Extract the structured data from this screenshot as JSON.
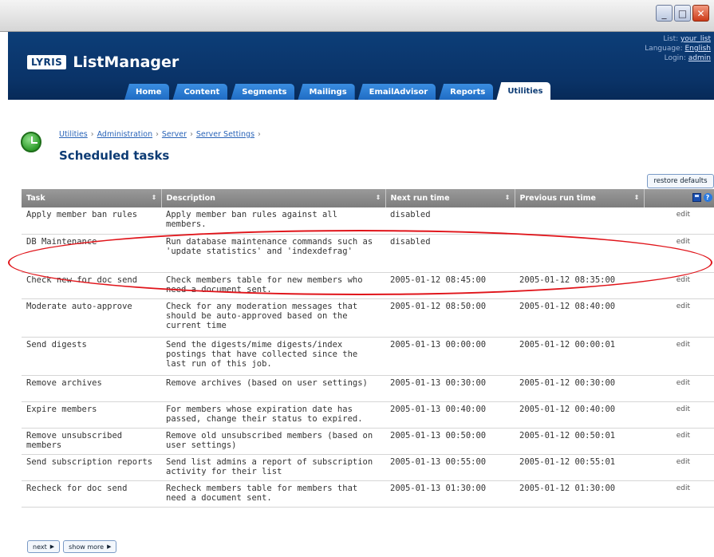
{
  "window": {
    "buttons": [
      "_",
      "□",
      "✕"
    ]
  },
  "header": {
    "logo_badge": "LYRIS",
    "app_name": "ListManager",
    "account": {
      "list_label": "List:",
      "list_value": "your_list",
      "language_label": "Language:",
      "language_value": "English",
      "login_label": "Login:",
      "login_value": "admin"
    },
    "tabs": [
      "Home",
      "Content",
      "Segments",
      "Mailings",
      "EmailAdvisor",
      "Reports",
      "Utilities"
    ],
    "active_tab": "Utilities"
  },
  "breadcrumb": [
    "Utilities",
    "Administration",
    "Server",
    "Server Settings"
  ],
  "page_title": "Scheduled tasks",
  "restore_label": "restore defaults",
  "table": {
    "columns": [
      "Task",
      "Description",
      "Next run time",
      "Previous run time"
    ],
    "rows": [
      {
        "task": "Apply member ban rules",
        "desc": "Apply member ban rules against all members.",
        "next": "disabled",
        "prev": "",
        "action": "edit"
      },
      {
        "task": "DB Maintenance",
        "desc": "Run database maintenance commands such as 'update statistics' and 'indexdefrag'",
        "next": "disabled",
        "prev": "",
        "action": "edit"
      },
      {
        "task": "Check new for doc send",
        "desc": "Check members table for new members who need a document sent.",
        "next": "2005-01-12 08:45:00",
        "prev": "2005-01-12 08:35:00",
        "action": "edit"
      },
      {
        "task": "Moderate auto-approve",
        "desc": "Check for any moderation messages that should be auto-approved based on the current time",
        "next": "2005-01-12 08:50:00",
        "prev": "2005-01-12 08:40:00",
        "action": "edit"
      },
      {
        "task": "Send digests",
        "desc": "Send the digests/mime digests/index postings that have collected since the last run of this job.",
        "next": "2005-01-13 00:00:00",
        "prev": "2005-01-12 00:00:01",
        "action": "edit"
      },
      {
        "task": "Remove archives",
        "desc": "Remove archives (based on user settings)",
        "next": "2005-01-13 00:30:00",
        "prev": "2005-01-12 00:30:00",
        "action": "edit"
      },
      {
        "task": "Expire members",
        "desc": "For members whose expiration date has passed, change their status to expired.",
        "next": "2005-01-13 00:40:00",
        "prev": "2005-01-12 00:40:00",
        "action": "edit"
      },
      {
        "task": "Remove unsubscribed members",
        "desc": "Remove old unsubscribed members (based on user settings)",
        "next": "2005-01-13 00:50:00",
        "prev": "2005-01-12 00:50:01",
        "action": "edit"
      },
      {
        "task": "Send subscription reports",
        "desc": "Send list admins a report of subscription activity for their list",
        "next": "2005-01-13 00:55:00",
        "prev": "2005-01-12 00:55:01",
        "action": "edit"
      },
      {
        "task": "Recheck for doc send",
        "desc": "Recheck members table for members that need a document sent.",
        "next": "2005-01-13 01:30:00",
        "prev": "2005-01-12 01:30:00",
        "action": "edit"
      }
    ]
  },
  "pager": {
    "next_label": "next",
    "show_more_label": "show more"
  },
  "colors": {
    "header_blue": "#0a3368",
    "tab_blue": "#1f6cc4",
    "highlight_red": "#e0141a"
  }
}
